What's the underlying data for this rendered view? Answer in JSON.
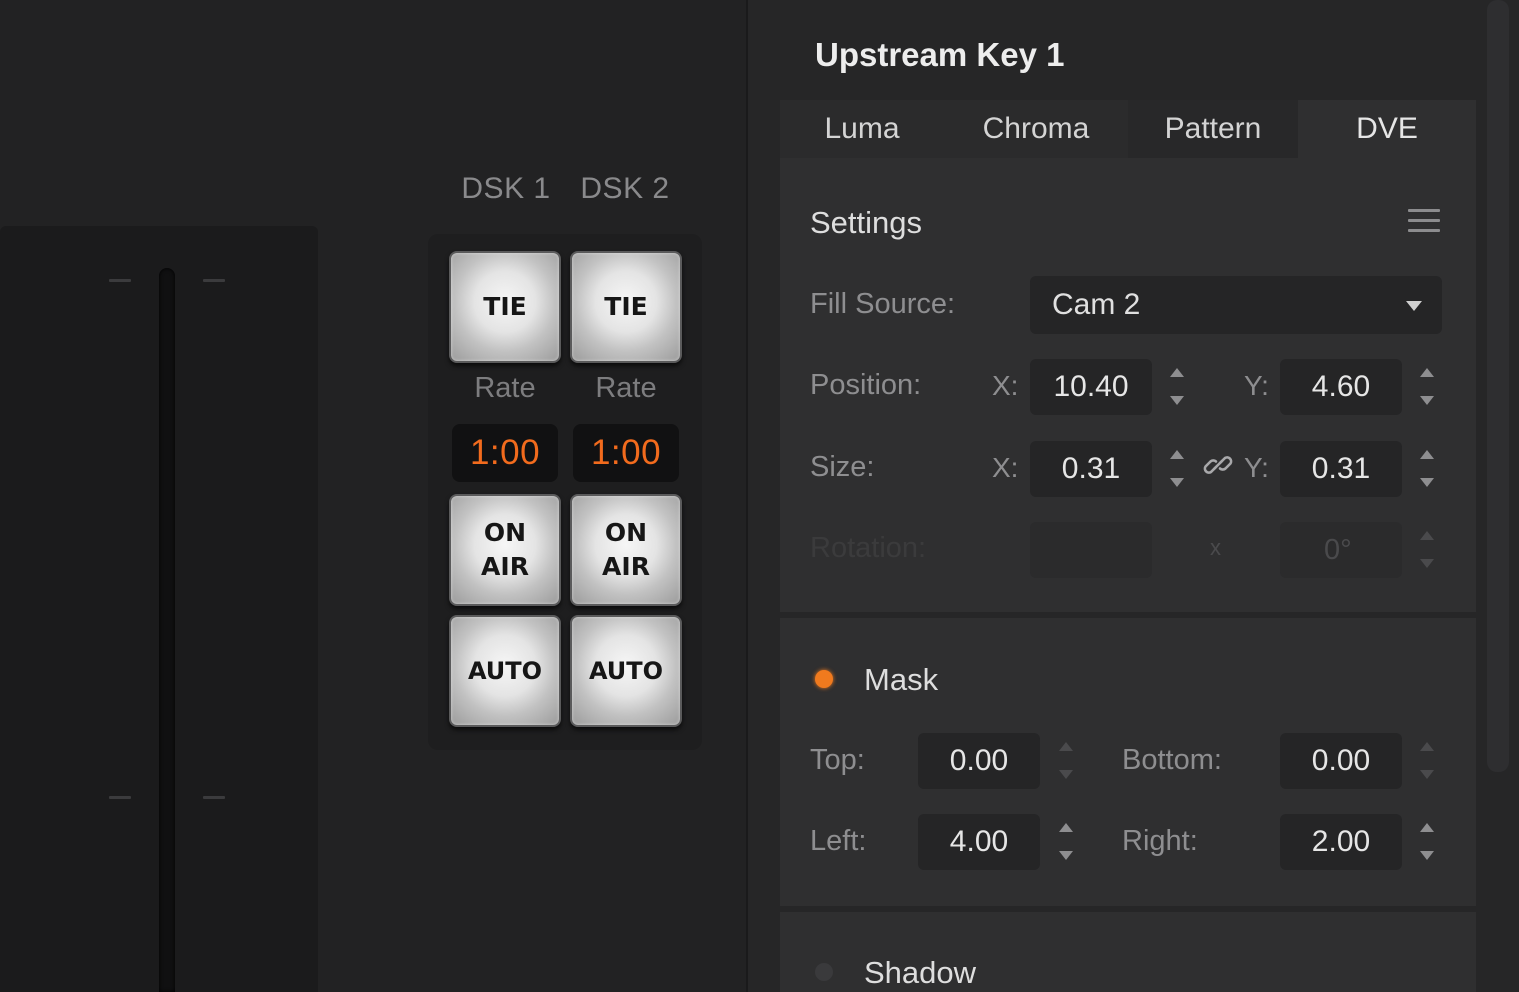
{
  "dsk": {
    "labels": [
      "DSK 1",
      "DSK 2"
    ],
    "tie_label": "TIE",
    "rate_label": "Rate",
    "rates": [
      "1:00",
      "1:00"
    ],
    "on_air_label": "ON\nAIR",
    "auto_label": "AUTO"
  },
  "panel": {
    "title": "Upstream Key 1",
    "tabs": [
      "Luma",
      "Chroma",
      "Pattern",
      "DVE"
    ],
    "active_tab": "DVE"
  },
  "settings": {
    "title": "Settings",
    "fill_source_label": "Fill Source:",
    "fill_source_value": "Cam 2",
    "position_label": "Position:",
    "position_x": "10.40",
    "position_y": "4.60",
    "size_label": "Size:",
    "size_x": "0.31",
    "size_y": "0.31",
    "axis_x": "X:",
    "axis_y": "Y:",
    "rotation_label": "Rotation:",
    "rotation_value": "0°",
    "rotation_mid": "x"
  },
  "mask": {
    "title": "Mask",
    "enabled_color": "#f07a1e",
    "top_label": "Top:",
    "top": "0.00",
    "bottom_label": "Bottom:",
    "bottom": "0.00",
    "left_label": "Left:",
    "left": "4.00",
    "right_label": "Right:",
    "right": "2.00"
  },
  "shadow": {
    "title": "Shadow",
    "enabled_color": "#3a3a3c"
  },
  "colors": {
    "accent": "#f26b1d",
    "background": "#222223",
    "panel": "#2f2f30"
  }
}
